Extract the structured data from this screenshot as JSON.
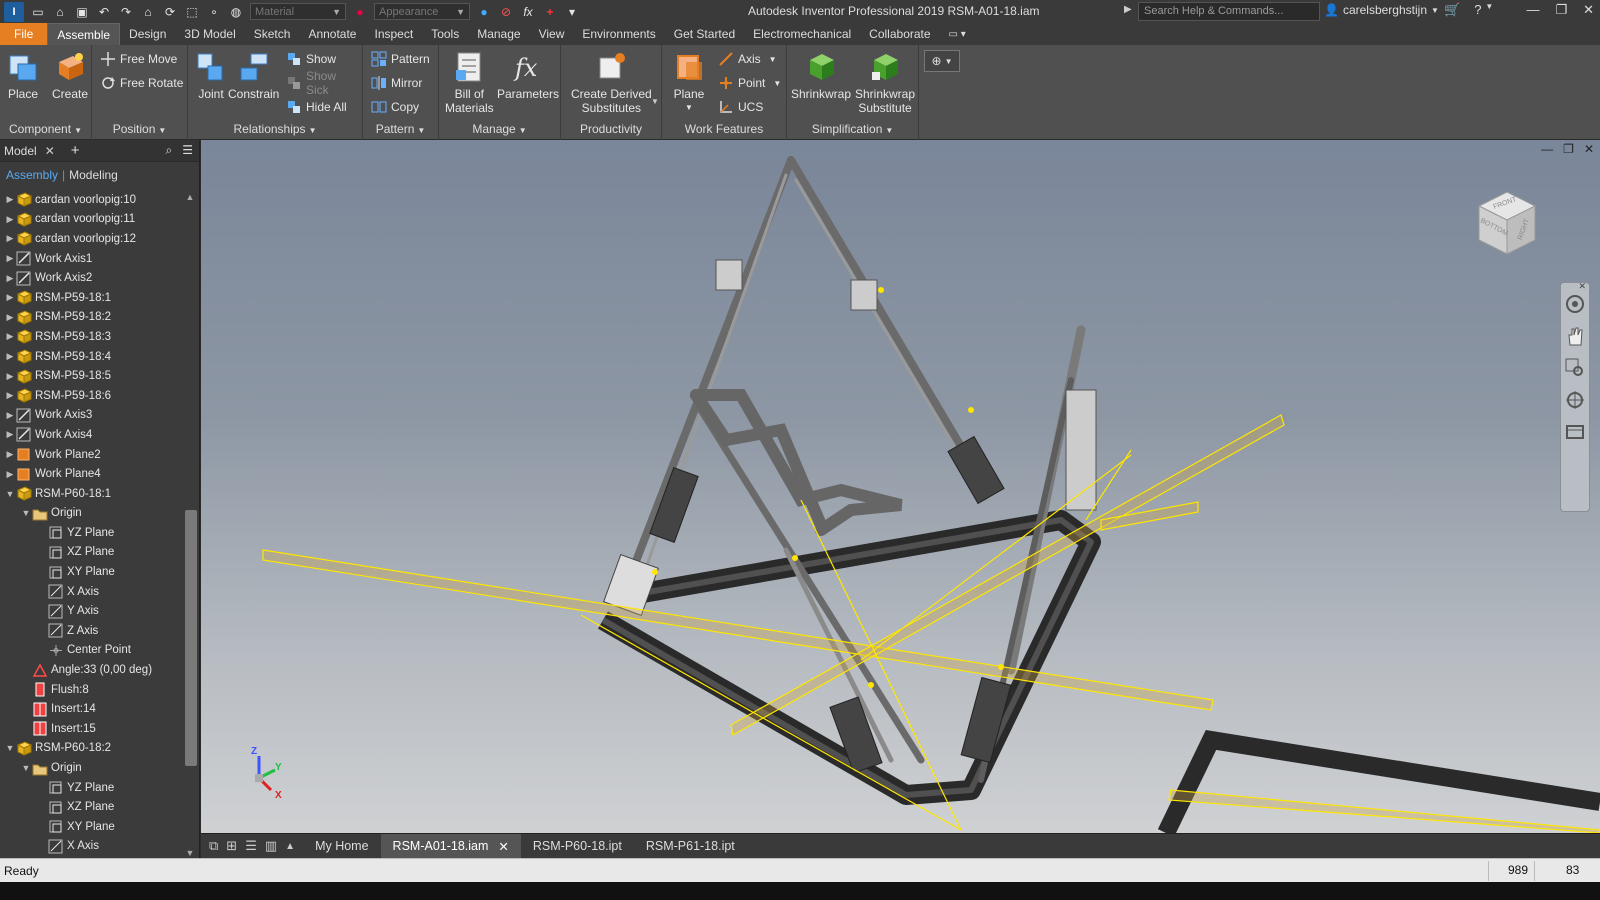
{
  "app": {
    "title": "Autodesk Inventor Professional 2019   RSM-A01-18.iam",
    "logo_text": "I",
    "material_placeholder": "Material",
    "appearance_placeholder": "Appearance",
    "search_placeholder": "Search Help & Commands...",
    "user": "carelsberghstijn"
  },
  "tabs": [
    "File",
    "Assemble",
    "Design",
    "3D Model",
    "Sketch",
    "Annotate",
    "Inspect",
    "Tools",
    "Manage",
    "View",
    "Environments",
    "Get Started",
    "Electromechanical",
    "Collaborate"
  ],
  "ribbon": {
    "component": {
      "label": "Component",
      "place": "Place",
      "create": "Create"
    },
    "position": {
      "label": "Position",
      "free_move": "Free Move",
      "free_rotate": "Free Rotate"
    },
    "relationships": {
      "label": "Relationships",
      "joint": "Joint",
      "constrain": "Constrain",
      "show": "Show",
      "show_sick": "Show Sick",
      "hide_all": "Hide All"
    },
    "pattern": {
      "label": "Pattern",
      "pattern": "Pattern",
      "mirror": "Mirror",
      "copy": "Copy"
    },
    "manage": {
      "label": "Manage",
      "bom_line1": "Bill of",
      "bom_line2": "Materials",
      "parameters": "Parameters"
    },
    "productivity": {
      "label": "Productivity",
      "cds_line1": "Create Derived",
      "cds_line2": "Substitutes"
    },
    "work_features": {
      "label": "Work Features",
      "plane": "Plane",
      "axis": "Axis",
      "point": "Point",
      "ucs": "UCS"
    },
    "simplification": {
      "label": "Simplification",
      "shrinkwrap": "Shrinkwrap",
      "sws_line1": "Shrinkwrap",
      "sws_line2": "Substitute"
    }
  },
  "browser": {
    "title": "Model",
    "sub_assembly": "Assembly",
    "sub_modeling": "Modeling",
    "tree": [
      {
        "label": "cardan voorlopig:10",
        "indent": 0,
        "exp": "right",
        "icon": "part-icon"
      },
      {
        "label": "cardan voorlopig:11",
        "indent": 0,
        "exp": "right",
        "icon": "part-icon"
      },
      {
        "label": "cardan voorlopig:12",
        "indent": 0,
        "exp": "right",
        "icon": "part-icon"
      },
      {
        "label": "Work Axis1",
        "indent": 0,
        "exp": "right",
        "icon": "work-axis-icon"
      },
      {
        "label": "Work Axis2",
        "indent": 0,
        "exp": "right",
        "icon": "work-axis-icon"
      },
      {
        "label": "RSM-P59-18:1",
        "indent": 0,
        "exp": "right",
        "icon": "part-icon"
      },
      {
        "label": "RSM-P59-18:2",
        "indent": 0,
        "exp": "right",
        "icon": "part-icon"
      },
      {
        "label": "RSM-P59-18:3",
        "indent": 0,
        "exp": "right",
        "icon": "part-icon"
      },
      {
        "label": "RSM-P59-18:4",
        "indent": 0,
        "exp": "right",
        "icon": "part-icon"
      },
      {
        "label": "RSM-P59-18:5",
        "indent": 0,
        "exp": "right",
        "icon": "part-icon"
      },
      {
        "label": "RSM-P59-18:6",
        "indent": 0,
        "exp": "right",
        "icon": "part-icon"
      },
      {
        "label": "Work Axis3",
        "indent": 0,
        "exp": "right",
        "icon": "work-axis-icon"
      },
      {
        "label": "Work Axis4",
        "indent": 0,
        "exp": "right",
        "icon": "work-axis-icon"
      },
      {
        "label": "Work Plane2",
        "indent": 0,
        "exp": "right",
        "icon": "work-plane-icon"
      },
      {
        "label": "Work Plane4",
        "indent": 0,
        "exp": "right",
        "icon": "work-plane-icon"
      },
      {
        "label": "RSM-P60-18:1",
        "indent": 0,
        "exp": "down",
        "icon": "part-icon"
      },
      {
        "label": "Origin",
        "indent": 1,
        "exp": "down",
        "icon": "folder-icon"
      },
      {
        "label": "YZ Plane",
        "indent": 2,
        "exp": "",
        "icon": "origin-plane-icon"
      },
      {
        "label": "XZ Plane",
        "indent": 2,
        "exp": "",
        "icon": "origin-plane-icon"
      },
      {
        "label": "XY Plane",
        "indent": 2,
        "exp": "",
        "icon": "origin-plane-icon"
      },
      {
        "label": "X Axis",
        "indent": 2,
        "exp": "",
        "icon": "origin-axis-icon"
      },
      {
        "label": "Y Axis",
        "indent": 2,
        "exp": "",
        "icon": "origin-axis-icon"
      },
      {
        "label": "Z Axis",
        "indent": 2,
        "exp": "",
        "icon": "origin-axis-icon"
      },
      {
        "label": "Center Point",
        "indent": 2,
        "exp": "",
        "icon": "center-point-icon"
      },
      {
        "label": "Angle:33 (0,00 deg)",
        "indent": 1,
        "exp": "",
        "icon": "angle-constraint-icon"
      },
      {
        "label": "Flush:8",
        "indent": 1,
        "exp": "",
        "icon": "flush-constraint-icon"
      },
      {
        "label": "Insert:14",
        "indent": 1,
        "exp": "",
        "icon": "insert-constraint-icon"
      },
      {
        "label": "Insert:15",
        "indent": 1,
        "exp": "",
        "icon": "insert-constraint-icon"
      },
      {
        "label": "RSM-P60-18:2",
        "indent": 0,
        "exp": "down",
        "icon": "part-icon"
      },
      {
        "label": "Origin",
        "indent": 1,
        "exp": "down",
        "icon": "folder-icon"
      },
      {
        "label": "YZ Plane",
        "indent": 2,
        "exp": "",
        "icon": "origin-plane-icon"
      },
      {
        "label": "XZ Plane",
        "indent": 2,
        "exp": "",
        "icon": "origin-plane-icon"
      },
      {
        "label": "XY Plane",
        "indent": 2,
        "exp": "",
        "icon": "origin-plane-icon"
      },
      {
        "label": "X Axis",
        "indent": 2,
        "exp": "",
        "icon": "origin-axis-icon"
      }
    ]
  },
  "viewcube": {
    "front": "FRONT",
    "bottom": "BOTTOM",
    "right": "RIGHT"
  },
  "triad": {
    "x": "X",
    "y": "Y",
    "z": "Z"
  },
  "doctabs": [
    "My Home",
    "RSM-A01-18.iam",
    "RSM-P60-18.ipt",
    "RSM-P61-18.ipt"
  ],
  "doctab_active": 1,
  "status": {
    "text": "Ready",
    "count1": "989",
    "count2": "83"
  },
  "colors": {
    "file_tab": "#e57f22",
    "accent_blue": "#5aa9f0",
    "work_feature_yellow": "#ffe600",
    "frame_dark": "#2b2b2b"
  }
}
